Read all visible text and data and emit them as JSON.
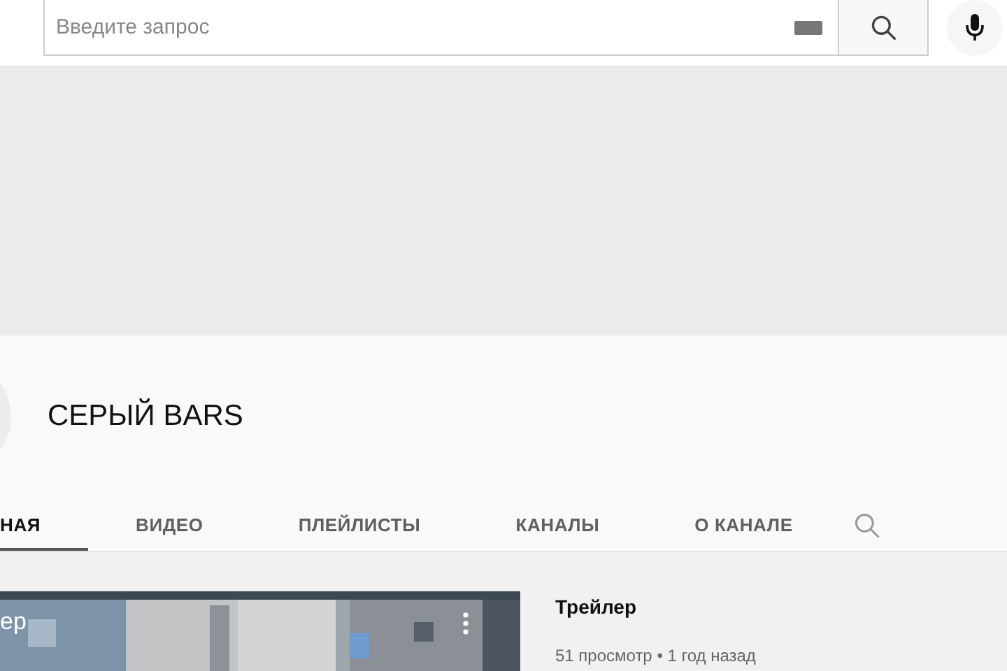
{
  "search": {
    "placeholder": "Введите запрос"
  },
  "channel": {
    "name": "СЕРЫЙ BARS"
  },
  "tabs": [
    {
      "label": "НАЯ",
      "selected": true
    },
    {
      "label": "ВИДЕО",
      "selected": false
    },
    {
      "label": "ПЛЕЙЛИСТЫ",
      "selected": false
    },
    {
      "label": "КАНАЛЫ",
      "selected": false
    },
    {
      "label": "О КАНАЛЕ",
      "selected": false
    }
  ],
  "featured_video": {
    "thumbnail": {
      "kind": "picture",
      "overlay_title": "ер"
    },
    "title": "Трейлер",
    "meta": "51 просмотр • 1 год назад"
  }
}
